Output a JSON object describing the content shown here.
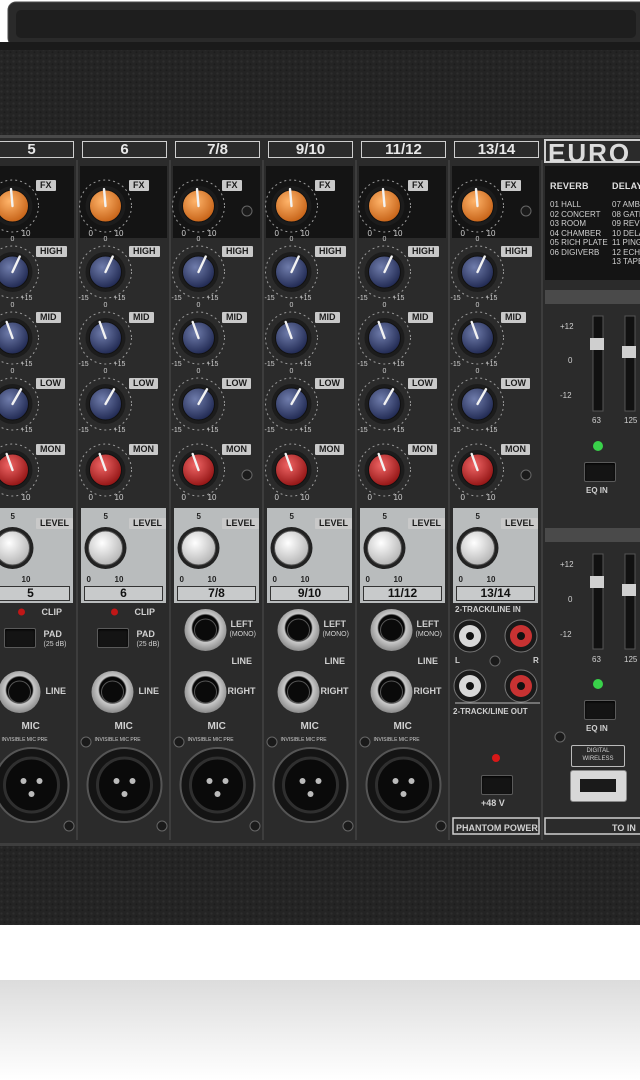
{
  "mixer": {
    "channels": [
      {
        "number": "5",
        "is_stereo": false
      },
      {
        "number": "6",
        "is_stereo": false
      },
      {
        "number": "7/8",
        "is_stereo": true
      },
      {
        "number": "9/10",
        "is_stereo": true
      },
      {
        "number": "11/12",
        "is_stereo": true
      },
      {
        "number": "13/14",
        "is_stereo": true
      }
    ],
    "labels": {
      "fx": "FX",
      "high": "HIGH",
      "mid": "MID",
      "low": "LOW",
      "mon": "MON",
      "level": "LEVEL",
      "clip": "CLIP",
      "pad": "PAD",
      "pad_sub": "(25 dB)",
      "line": "LINE",
      "mic": "MIC",
      "left": "LEFT",
      "mono": "(MONO)",
      "right": "RIGHT",
      "invisible_mic_pre": "INVISIBLE MIC PRE",
      "scale_0": "0",
      "scale_10": "10",
      "scale_5": "5",
      "scale_neg15": "-15",
      "scale_pos15": "+15",
      "two_track_line_in": "2-TRACK/LINE IN",
      "two_track_line_out": "2-TRACK/LINE OUT",
      "l": "L",
      "r": "R",
      "phantom_48v": "+48 V",
      "phantom_power": "PHANTOM POWER"
    },
    "brand_partial": "EURO",
    "fx_presets": {
      "reverb_title": "REVERB",
      "reverb": [
        "01 HALL",
        "02 CONCERT",
        "03 ROOM",
        "04 CHAMBER",
        "05 RICH PLATE",
        "06 DIGIVERB"
      ],
      "delay_title": "DELAY",
      "delay": [
        "07 AMB",
        "08 GATE",
        "09 REV",
        "10 DELA",
        "11 PING",
        "12 ECHO",
        "13 TAPE"
      ]
    },
    "eq_section": {
      "scale": [
        "+12",
        "0",
        "-12"
      ],
      "freqs": [
        "63",
        "125"
      ],
      "eq_in": "EQ IN"
    },
    "wireless": {
      "line1": "DIGITAL",
      "line2": "WIRELESS"
    },
    "to_label": "TO IN"
  },
  "colors": {
    "fx_knob": "#e8862a",
    "eq_knob": "#34406e",
    "mon_knob": "#c8282a",
    "level_knob": "#eeeeee",
    "led_green": "#39d14a",
    "led_red": "#d81818"
  }
}
